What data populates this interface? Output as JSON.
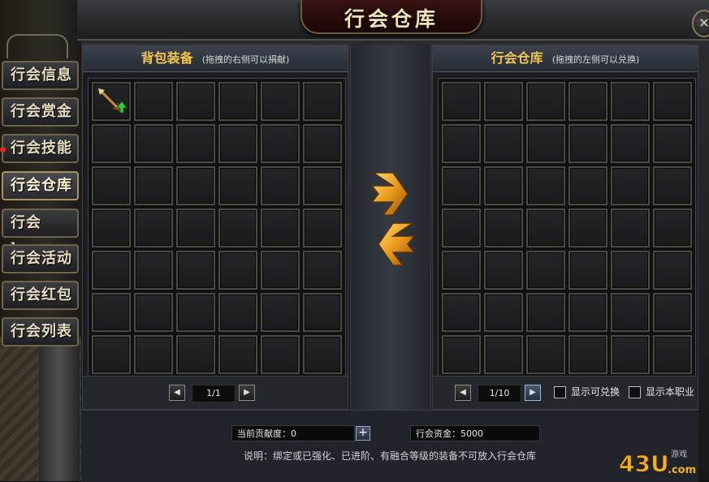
{
  "window": {
    "title": "行会仓库",
    "close_label": "×"
  },
  "sidebar": {
    "tabs": [
      {
        "label": "行会信息",
        "active": false,
        "notify": false
      },
      {
        "label": "行会赏金",
        "active": false,
        "notify": false
      },
      {
        "label": "行会技能",
        "active": false,
        "notify": true
      },
      {
        "label": "行会仓库",
        "active": true,
        "notify": false
      },
      {
        "label": "行会boss",
        "active": false,
        "notify": false
      },
      {
        "label": "行会活动",
        "active": false,
        "notify": false
      },
      {
        "label": "行会红包",
        "active": false,
        "notify": false
      },
      {
        "label": "行会列表",
        "active": false,
        "notify": false
      }
    ]
  },
  "backpack": {
    "title": "背包装备",
    "hint": "(拖拽的右侧可以捐献)",
    "rows": 7,
    "cols": 6,
    "items": [
      {
        "slot": 0,
        "icon": "arrow-weapon-icon",
        "upgrade": true
      }
    ],
    "page": "1/1",
    "prev_label": "◀",
    "next_label": "▶"
  },
  "warehouse": {
    "title": "行会仓库",
    "hint": "(拖拽的左侧可以兑换)",
    "rows": 7,
    "cols": 6,
    "items": [],
    "page": "1/10",
    "prev_label": "◀",
    "next_label": "▶",
    "filter_exchangeable": "显示可兑换",
    "filter_own_class": "显示本职业"
  },
  "transfer": {
    "icon": "swap-arrows-icon"
  },
  "footer": {
    "contribution_label": "当前贡献度：",
    "contribution_value": "0",
    "contribution_text": "当前贡献度：0",
    "add_label": "+",
    "funds_text": "行会资金：5000",
    "note": "说明：绑定或已强化、已进阶、有融合等级的装备不可放入行会仓库"
  },
  "watermark": {
    "text": "43U",
    "suffix": ".com",
    "small": "游戏"
  },
  "colors": {
    "title_gold": "#f4c64d",
    "accent_orange": "#e89a1c",
    "upgrade_green": "#2fd23a"
  }
}
